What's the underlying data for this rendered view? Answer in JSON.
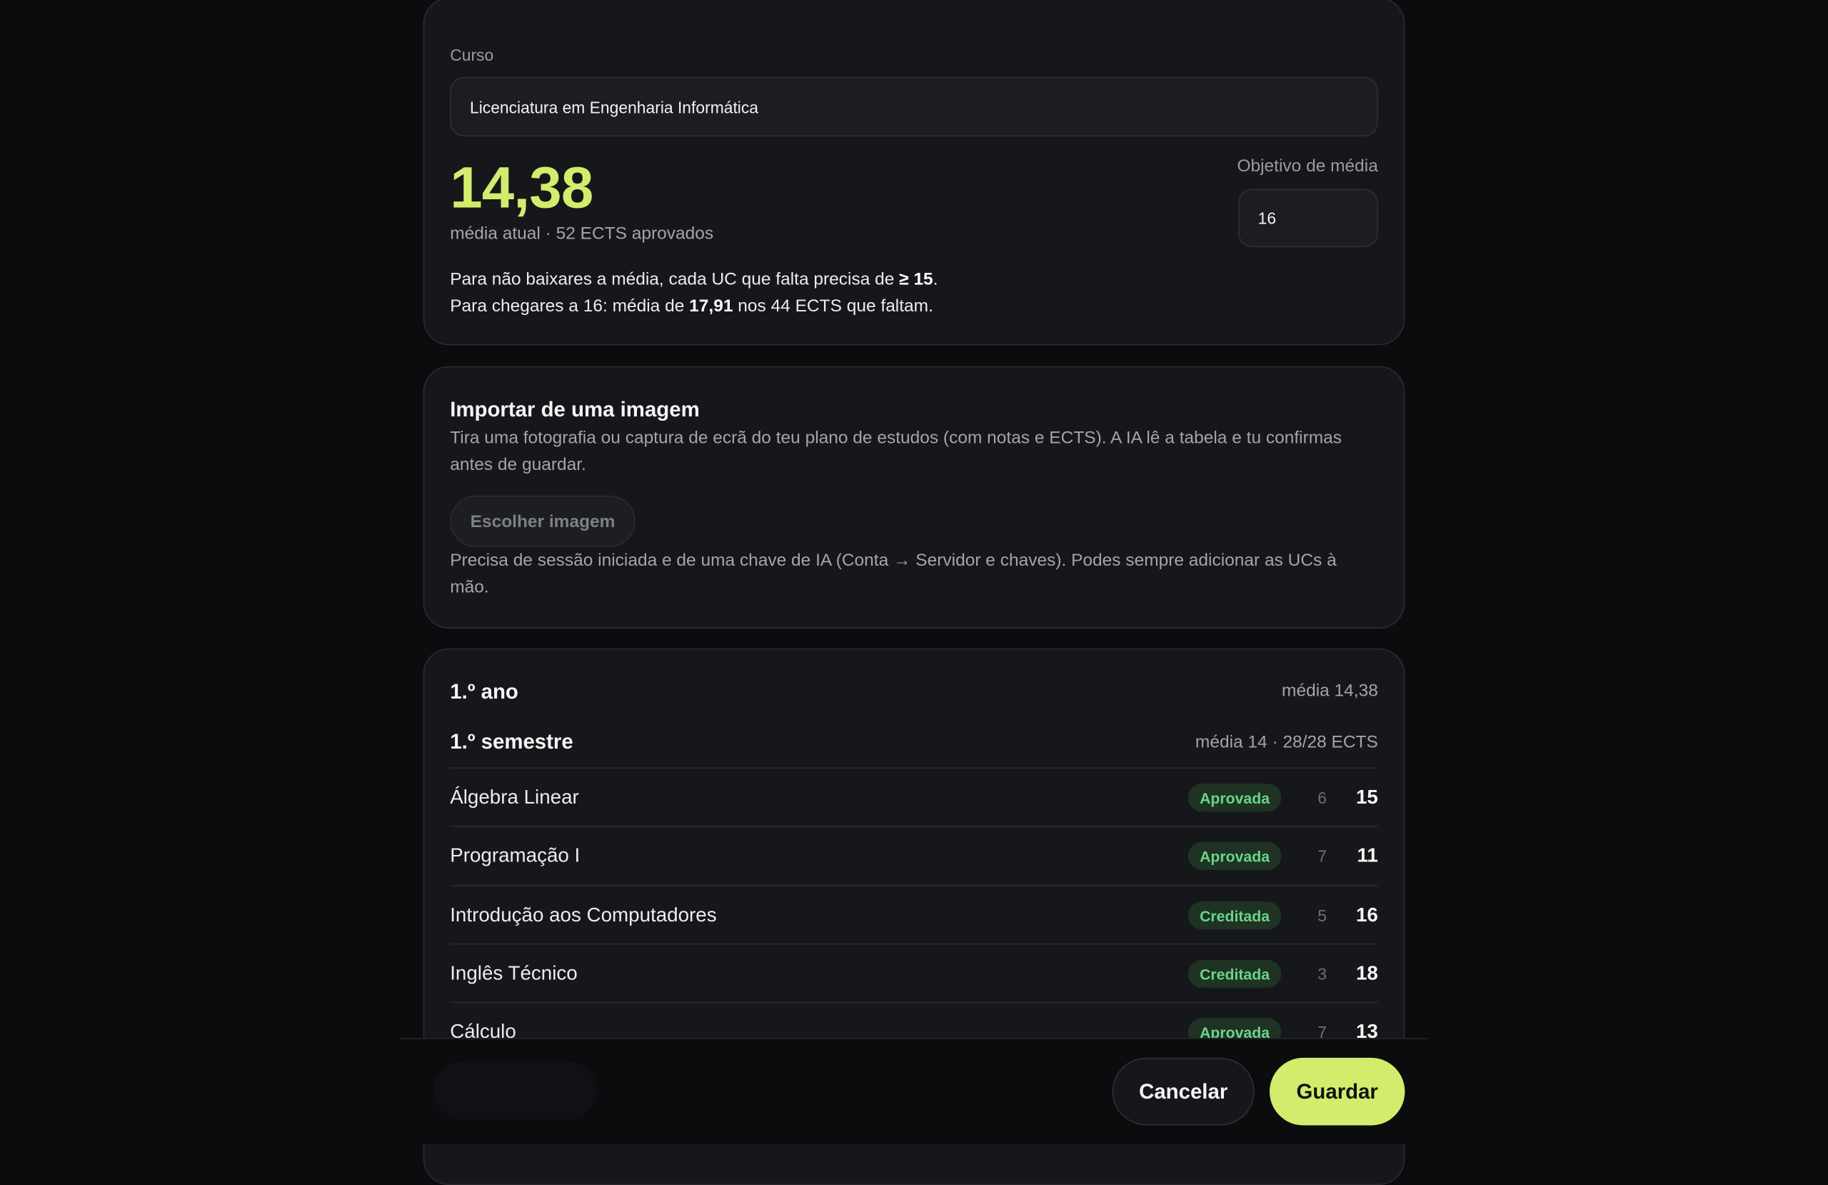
{
  "course": {
    "label": "Curso",
    "value": "Licenciatura em Engenharia Informática",
    "average": "14,38",
    "average_sub": "média atual · 52 ECTS aprovados",
    "goal_label": "Objetivo de média",
    "goal_value": "16",
    "line1_pre": "Para não baixares a média, cada UC que falta precisa de ",
    "line1_bold": "≥ 15",
    "line1_post": ".",
    "line2_pre": "Para chegares a 16: média de ",
    "line2_bold": "17,91",
    "line2_post": " nos 44 ECTS que faltam."
  },
  "import": {
    "title": "Importar de uma imagem",
    "description": "Tira uma fotografia ou captura de ecrã do teu plano de estudos (com notas e ECTS). A IA lê a tabela e tu confirmas antes de guardar.",
    "button": "Escolher imagem",
    "note": "Precisa de sessão iniciada e de uma chave de IA (Conta → Servidor e chaves). Podes sempre adicionar as UCs à mão."
  },
  "plan": {
    "year_title": "1.º ano",
    "year_avg": "média 14,38",
    "semester_title": "1.º semestre",
    "semester_avg": "média 14 · 28/28 ECTS",
    "rows": [
      {
        "name": "Álgebra Linear",
        "status": "Aprovada",
        "ects": "6",
        "grade": "15"
      },
      {
        "name": "Programação I",
        "status": "Aprovada",
        "ects": "7",
        "grade": "11"
      },
      {
        "name": "Introdução aos Computadores",
        "status": "Creditada",
        "ects": "5",
        "grade": "16"
      },
      {
        "name": "Inglês Técnico",
        "status": "Creditada",
        "ects": "3",
        "grade": "18"
      },
      {
        "name": "Cálculo",
        "status": "Aprovada",
        "ects": "7",
        "grade": "13"
      }
    ]
  },
  "footer": {
    "cancel": "Cancelar",
    "save": "Guardar"
  },
  "colors": {
    "accent": "#d4ec6b",
    "badge_bg": "#1e3324",
    "badge_text": "#6bd48a"
  }
}
